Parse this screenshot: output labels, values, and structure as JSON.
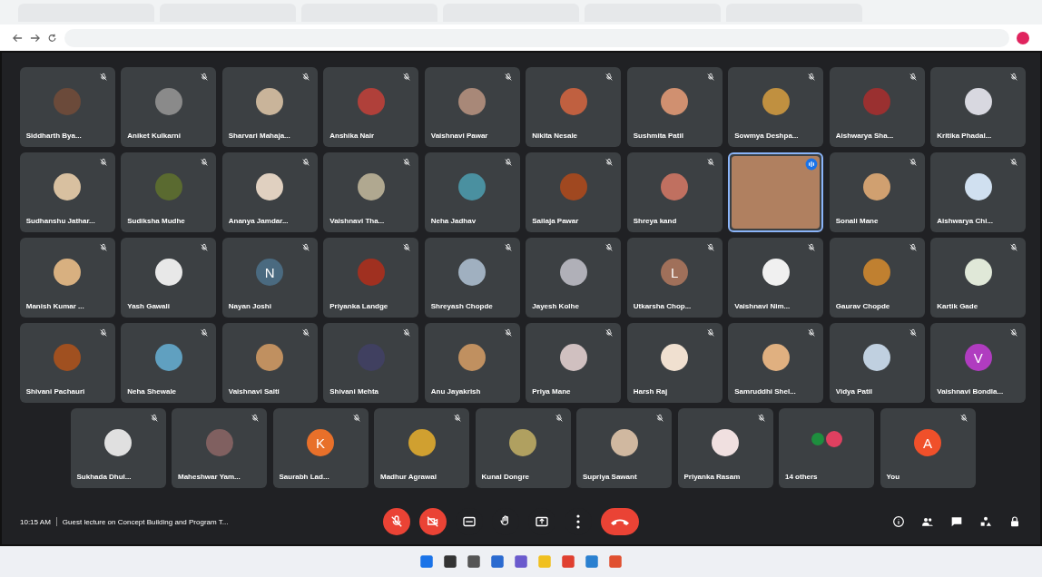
{
  "tiles": [
    {
      "name": "Siddharth Bya...",
      "kind": "photo",
      "color": "#6b4a3a",
      "muted": true,
      "selected": false
    },
    {
      "name": "Aniket Kulkarni",
      "kind": "photo",
      "color": "#8a8a8a",
      "muted": true,
      "selected": false
    },
    {
      "name": "Sharvari Mahaja...",
      "kind": "photo",
      "color": "#c9b49a",
      "muted": true,
      "selected": false
    },
    {
      "name": "Anshika Nair",
      "kind": "photo",
      "color": "#b0403a",
      "muted": true,
      "selected": false
    },
    {
      "name": "Vaishnavi Pawar",
      "kind": "photo",
      "color": "#a88878",
      "muted": true,
      "selected": false
    },
    {
      "name": "Nikita Nesale",
      "kind": "photo",
      "color": "#c06040",
      "muted": true,
      "selected": false
    },
    {
      "name": "Sushmita Patil",
      "kind": "photo",
      "color": "#d09070",
      "muted": true,
      "selected": false
    },
    {
      "name": "Sowmya Deshpa...",
      "kind": "photo",
      "color": "#c09040",
      "muted": true,
      "selected": false
    },
    {
      "name": "Aishwarya Sha...",
      "kind": "photo",
      "color": "#9a3030",
      "muted": true,
      "selected": false
    },
    {
      "name": "Kritika Phadal...",
      "kind": "photo",
      "color": "#d8d8e0",
      "muted": true,
      "selected": false
    },
    {
      "name": "Sudhanshu Jathar...",
      "kind": "photo",
      "color": "#d8c0a0",
      "muted": true,
      "selected": false
    },
    {
      "name": "Sudiksha Mudhe",
      "kind": "photo",
      "color": "#5a6a30",
      "muted": true,
      "selected": false
    },
    {
      "name": "Ananya Jamdar...",
      "kind": "photo",
      "color": "#e0d0c0",
      "muted": true,
      "selected": false
    },
    {
      "name": "Vaishnavi Tha...",
      "kind": "photo",
      "color": "#b0a890",
      "muted": true,
      "selected": false
    },
    {
      "name": "Neha Jadhav",
      "kind": "photo",
      "color": "#4a90a0",
      "muted": true,
      "selected": false
    },
    {
      "name": "Sailaja Pawar",
      "kind": "photo",
      "color": "#a04820",
      "muted": true,
      "selected": false
    },
    {
      "name": "Shreya kand",
      "kind": "photo",
      "color": "#c07060",
      "muted": true,
      "selected": false
    },
    {
      "kind": "video",
      "color": "#b08060",
      "muted": false,
      "selected": true
    },
    {
      "name": "Sonali Mane",
      "kind": "photo",
      "color": "#d0a070",
      "muted": true,
      "selected": false
    },
    {
      "name": "Aishwarya Chi...",
      "kind": "photo",
      "color": "#d0e0f0",
      "muted": true,
      "selected": false
    },
    {
      "name": "Manish Kumar ...",
      "kind": "photo",
      "color": "#d8b080",
      "muted": true,
      "selected": false
    },
    {
      "name": "Yash Gawali",
      "kind": "photo",
      "color": "#e8e8e8",
      "muted": true,
      "selected": false
    },
    {
      "name": "Nayan Joshi",
      "kind": "letter",
      "letter": "N",
      "color": "#4a6a80",
      "muted": true,
      "selected": false
    },
    {
      "name": "Priyanka Landge",
      "kind": "photo",
      "color": "#a03020",
      "muted": true,
      "selected": false
    },
    {
      "name": "Shreyash Chopde",
      "kind": "photo",
      "color": "#a0b0c0",
      "muted": true,
      "selected": false
    },
    {
      "name": "Jayesh Kolhe",
      "kind": "photo",
      "color": "#b0b0b8",
      "muted": true,
      "selected": false
    },
    {
      "name": "Utkarsha Chop...",
      "kind": "letter",
      "letter": "L",
      "color": "#a0705a",
      "muted": true,
      "selected": false
    },
    {
      "name": "Vaishnavi Nim...",
      "kind": "photo",
      "color": "#f0f0f0",
      "muted": true,
      "selected": false
    },
    {
      "name": "Gaurav Chopde",
      "kind": "photo",
      "color": "#c08030",
      "muted": true,
      "selected": false
    },
    {
      "name": "Kartik Gade",
      "kind": "photo",
      "color": "#e0e8d8",
      "muted": true,
      "selected": false
    },
    {
      "name": "Shivani Pachauri",
      "kind": "photo",
      "color": "#a05020",
      "muted": true,
      "selected": false
    },
    {
      "name": "Neha Shewale",
      "kind": "photo",
      "color": "#60a0c0",
      "muted": true,
      "selected": false
    },
    {
      "name": "Vaishnavi Salti",
      "kind": "photo",
      "color": "#c09060",
      "muted": true,
      "selected": false
    },
    {
      "name": "Shivani Mehta",
      "kind": "photo",
      "color": "#404060",
      "muted": true,
      "selected": false
    },
    {
      "name": "Anu Jayakrish",
      "kind": "photo",
      "color": "#c09060",
      "muted": true,
      "selected": false
    },
    {
      "name": "Priya Mane",
      "kind": "photo",
      "color": "#d0c0c0",
      "muted": true,
      "selected": false
    },
    {
      "name": "Harsh Raj",
      "kind": "photo",
      "color": "#f0e0d0",
      "muted": true,
      "selected": false
    },
    {
      "name": "Samruddhi Shel...",
      "kind": "photo",
      "color": "#e0b080",
      "muted": true,
      "selected": false
    },
    {
      "name": "Vidya Patil",
      "kind": "photo",
      "color": "#c0d0e0",
      "muted": true,
      "selected": false
    },
    {
      "name": "Vaishnavi Bondla...",
      "kind": "letter",
      "letter": "V",
      "color": "#b03cc0",
      "muted": true,
      "selected": false
    },
    {
      "name": "Sukhada Dhul...",
      "kind": "photo",
      "color": "#e0e0e0",
      "muted": true,
      "selected": false
    },
    {
      "name": "Maheshwar Yam...",
      "kind": "photo",
      "color": "#806060",
      "muted": true,
      "selected": false
    },
    {
      "name": "Saurabh Lad...",
      "kind": "letter",
      "letter": "K",
      "color": "#e8702a",
      "muted": true,
      "selected": false
    },
    {
      "name": "Madhur Agrawal",
      "kind": "photo",
      "color": "#d0a030",
      "muted": true,
      "selected": false
    },
    {
      "name": "Kunal Dongre",
      "kind": "photo",
      "color": "#b0a060",
      "muted": true,
      "selected": false
    },
    {
      "name": "Supriya Sawant",
      "kind": "photo",
      "color": "#d0b8a0",
      "muted": true,
      "selected": false
    },
    {
      "name": "Priyanka Rasam",
      "kind": "photo",
      "color": "#f0e0e0",
      "muted": true,
      "selected": false
    },
    {
      "name": "14 others",
      "kind": "others",
      "color": "#e04060",
      "muted": false,
      "selected": false
    },
    {
      "name": "You",
      "kind": "letter",
      "letter": "A",
      "color": "#f0502a",
      "muted": true,
      "selected": false
    }
  ],
  "time": "10:15 AM",
  "meeting_title": "Guest lecture on Concept Building and Program T...",
  "controls": [
    {
      "kind": "mic",
      "on": false
    },
    {
      "kind": "camera",
      "on": false
    },
    {
      "kind": "captions"
    },
    {
      "kind": "hand"
    },
    {
      "kind": "present"
    },
    {
      "kind": "more"
    },
    {
      "kind": "end"
    }
  ],
  "side_controls": [
    {
      "kind": "info"
    },
    {
      "kind": "people"
    },
    {
      "kind": "chat"
    },
    {
      "kind": "activities"
    },
    {
      "kind": "lock"
    }
  ]
}
